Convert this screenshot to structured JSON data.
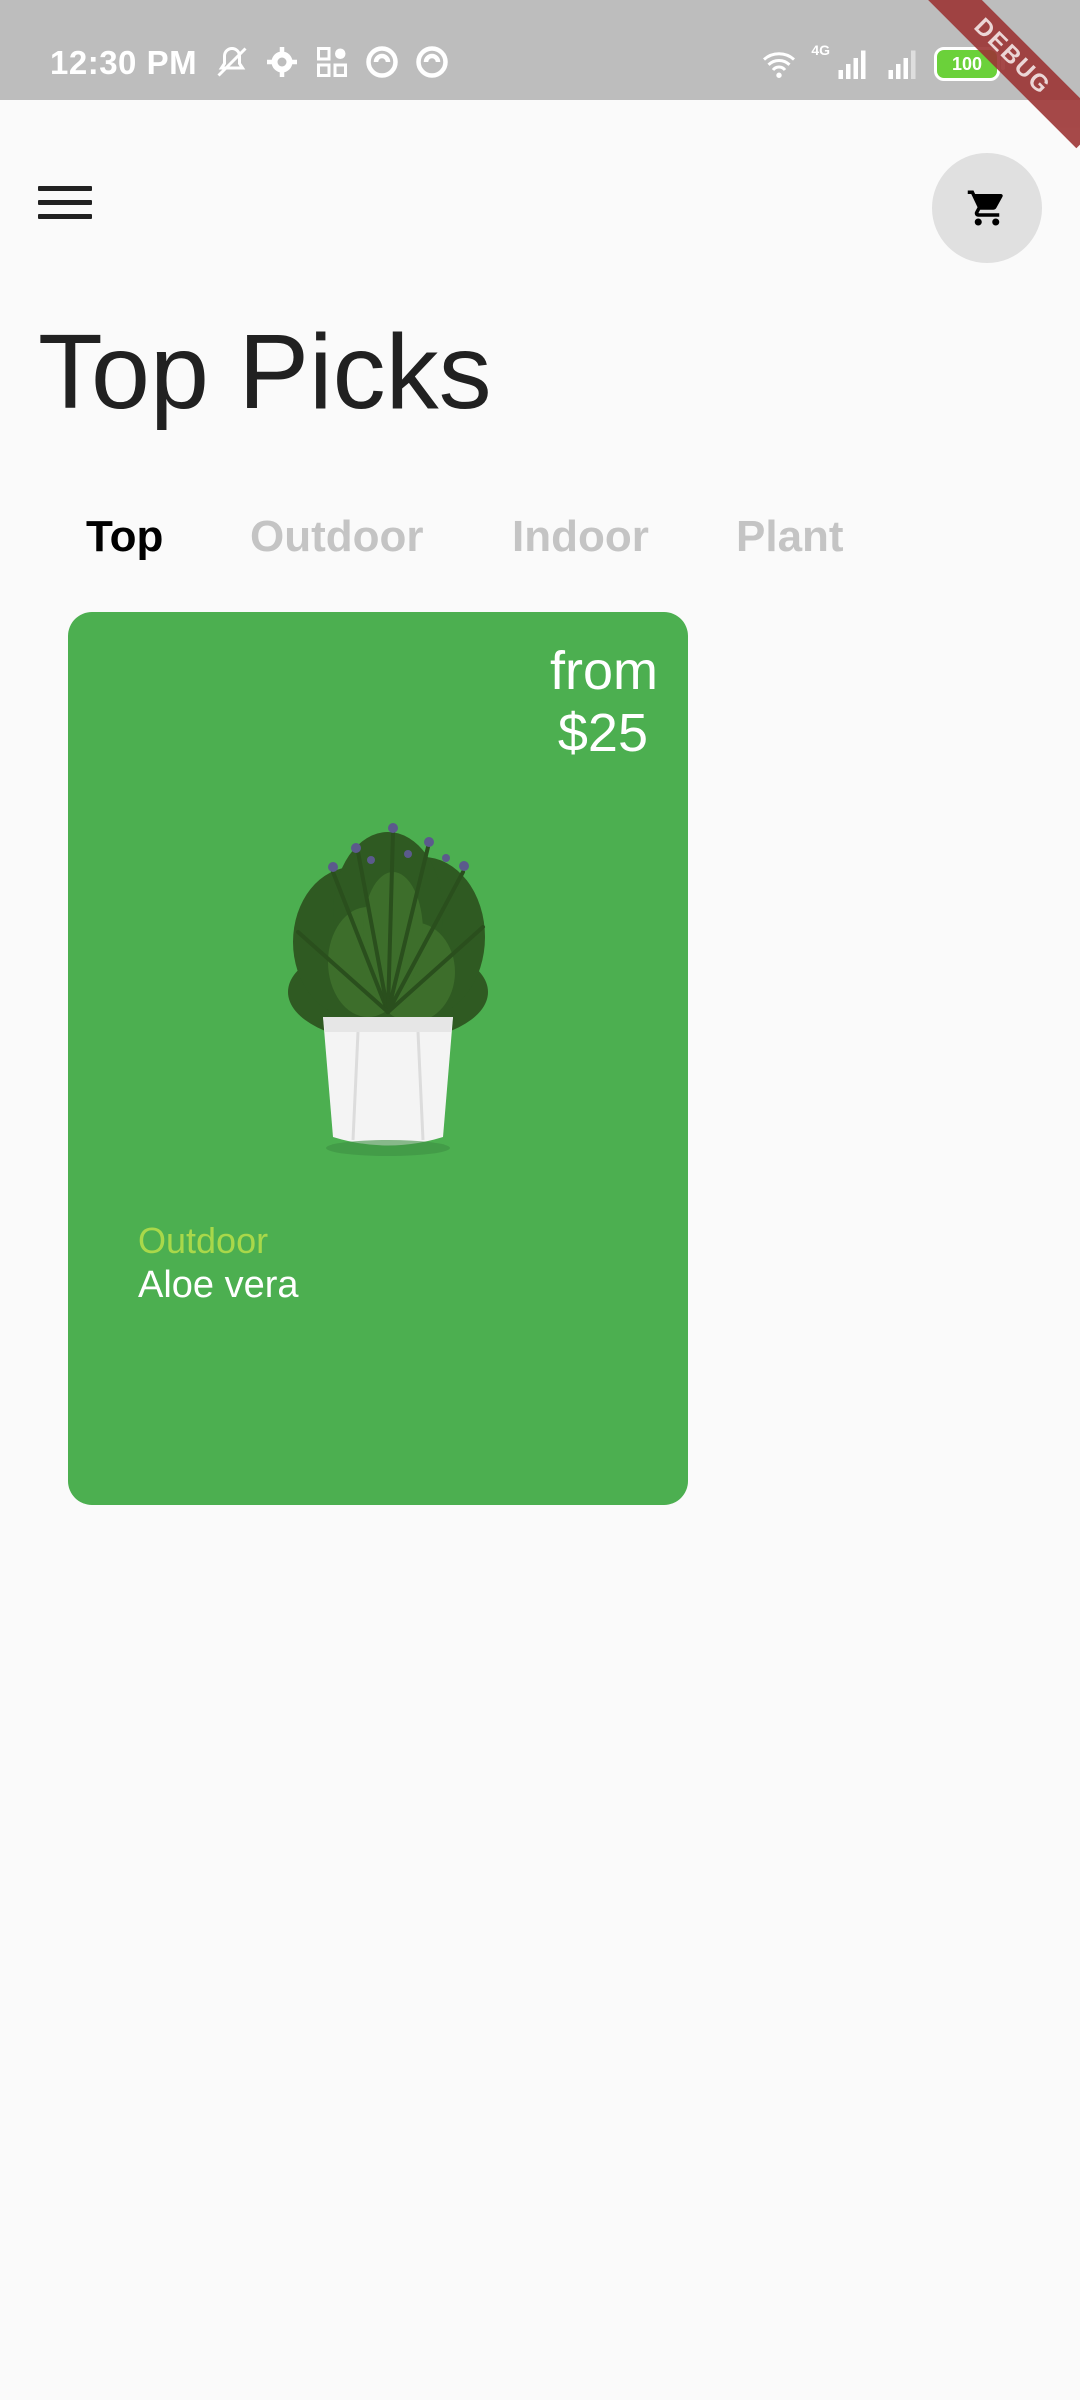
{
  "status_bar": {
    "time": "12:30 PM",
    "network_label": "4G",
    "battery": "100",
    "icons": [
      "mute-icon",
      "settings-icon",
      "grid-icon",
      "circle-app-icon",
      "circle-app-icon",
      "wifi-icon",
      "signal-icon",
      "signal-icon",
      "battery-icon",
      "charging-icon"
    ]
  },
  "debug_banner": "DEBUG",
  "header": {
    "menu_icon": "menu-icon",
    "cart_icon": "shopping-cart-icon"
  },
  "page": {
    "title": "Top Picks"
  },
  "tabs": [
    {
      "label": "Top",
      "active": true
    },
    {
      "label": "Outdoor",
      "active": false
    },
    {
      "label": "Indoor",
      "active": false
    },
    {
      "label": "Plant",
      "active": false
    }
  ],
  "products": [
    {
      "price_prefix": "from",
      "price": "$25",
      "category": "Outdoor",
      "name": "Aloe vera",
      "card_color": "#4caf50",
      "category_color": "#a9d84a"
    }
  ],
  "colors": {
    "background": "#fafafa",
    "status_bar": "#bdbdbd",
    "title": "#212121",
    "tab_inactive": "#c4c4c4",
    "tab_active": "#000000"
  }
}
